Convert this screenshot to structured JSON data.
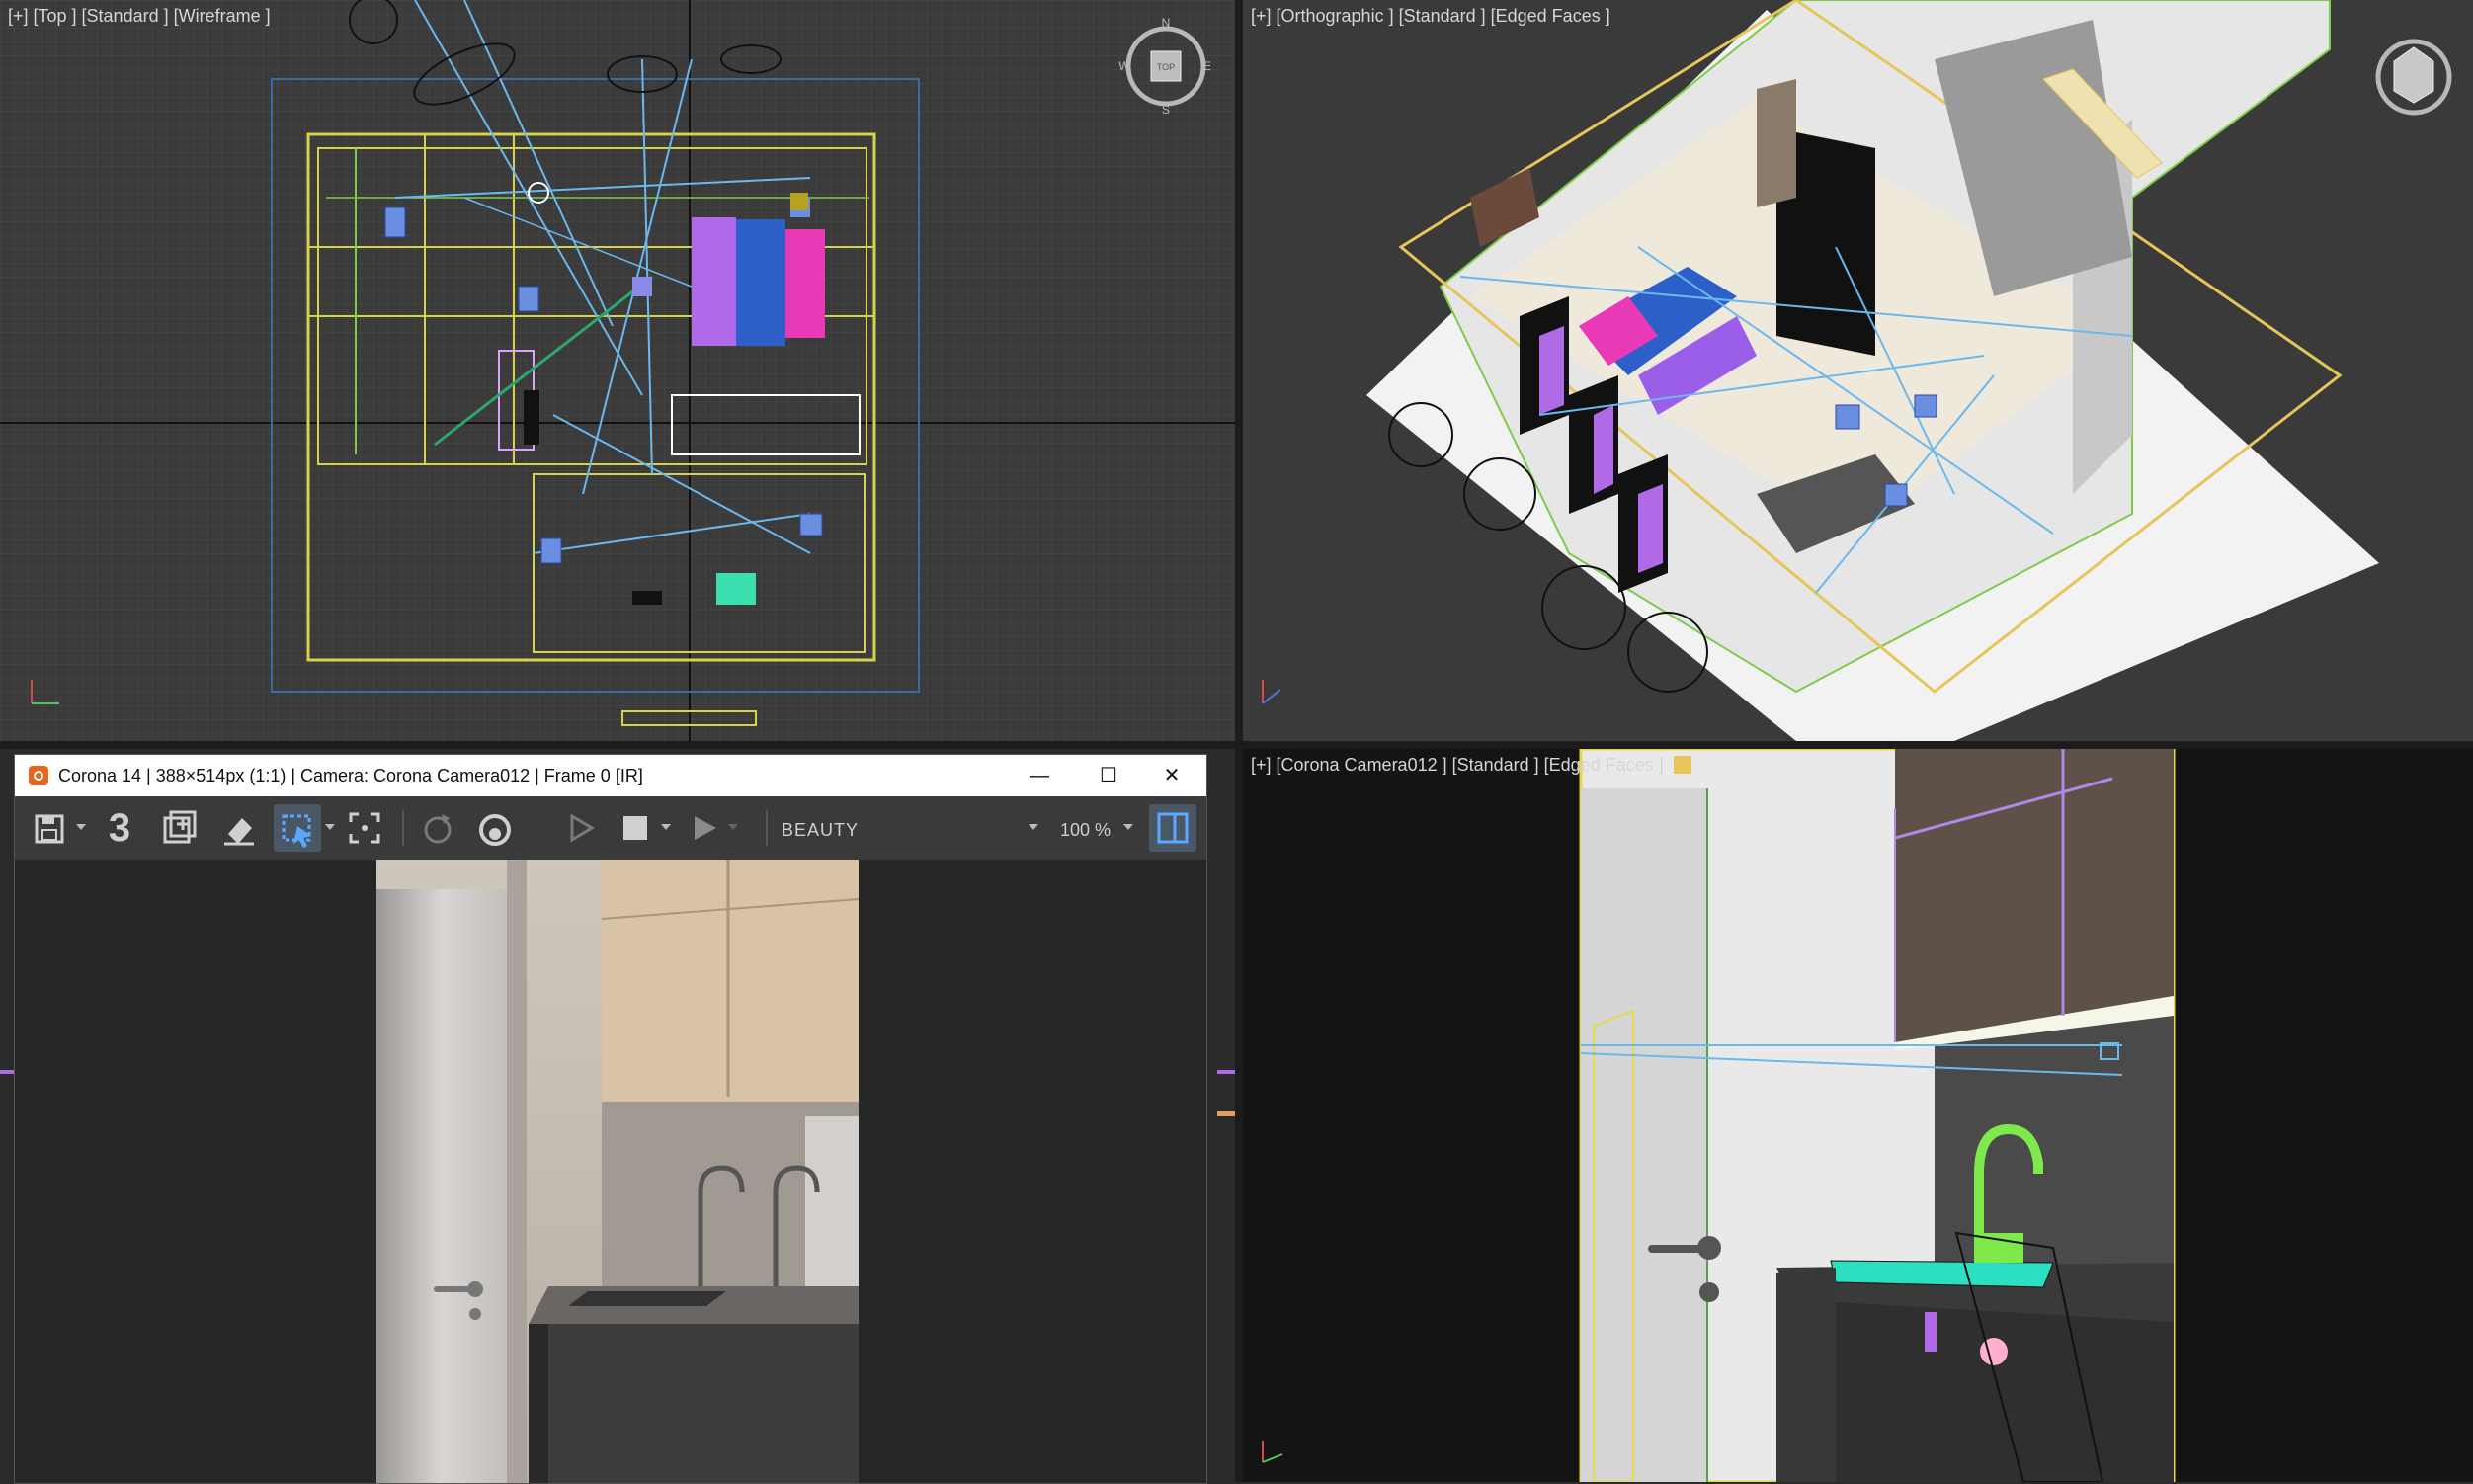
{
  "viewports": {
    "top": {
      "label": "[+] [Top ] [Standard ] [Wireframe ]"
    },
    "ortho": {
      "label": "[+] [Orthographic ] [Standard ] [Edged Faces ]"
    },
    "camera": {
      "label": "[+] [Corona Camera012 ] [Standard ] [Edged Faces ]"
    },
    "viewcube": {
      "north": "N",
      "south": "S",
      "east": "E",
      "west": "W",
      "face": "TOP"
    }
  },
  "vfb": {
    "title": "Corona 14 | 388×514px (1:1) | Camera: Corona Camera012 | Frame 0 [IR]",
    "buttons": {
      "minimize": "—",
      "maximize": "☐",
      "close": "✕"
    },
    "toolbar": {
      "counter": "3",
      "pass": "BEAUTY",
      "zoom": "100 %"
    }
  },
  "colors": {
    "wire_yellow": "#d8d24a",
    "camera_blue": "#6ab8ee",
    "selection_yellow": "#e8c55a",
    "corona_orange": "#e8651a"
  }
}
